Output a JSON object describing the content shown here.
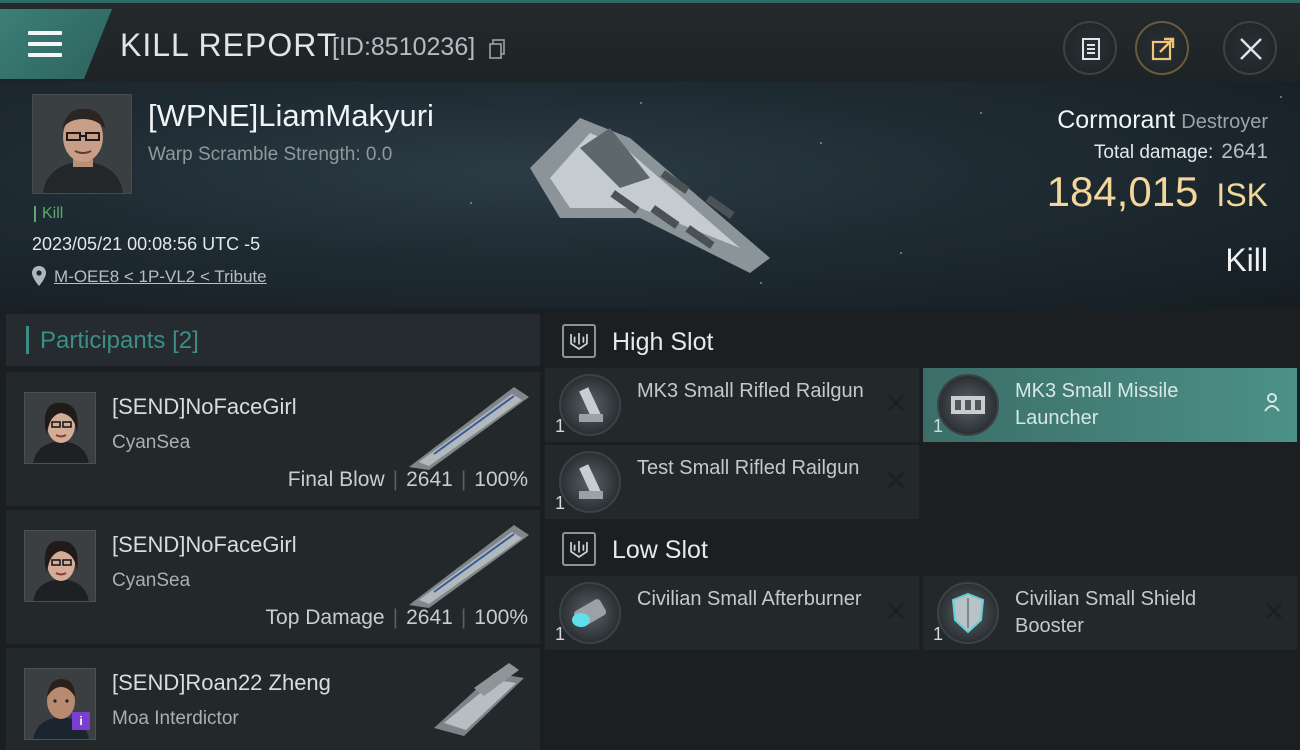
{
  "header": {
    "title": "KILL REPORT",
    "report_id": "[ID:8510236]"
  },
  "victim": {
    "name": "[WPNE]LiamMakyuri",
    "warp_scramble": "Warp Scramble Strength: 0.0",
    "tag": "Kill",
    "timestamp": "2023/05/21 00:08:56 UTC -5",
    "location": "M-OEE8 < 1P-VL2 < Tribute",
    "ship_name": "Cormorant",
    "ship_class": "Destroyer",
    "total_damage_label": "Total damage:",
    "total_damage": "2641",
    "isk_value": "184,015",
    "isk_unit": "ISK",
    "result": "Kill"
  },
  "participants": {
    "title": "Participants",
    "count": "[2]",
    "rows": [
      {
        "name": "[SEND]NoFaceGirl",
        "corp": "CyanSea",
        "role": "Final Blow",
        "damage": "2641",
        "percent": "100%"
      },
      {
        "name": "[SEND]NoFaceGirl",
        "corp": "CyanSea",
        "role": "Top Damage",
        "damage": "2641",
        "percent": "100%"
      },
      {
        "name": "[SEND]Roan22 Zheng",
        "corp": "Moa Interdictor",
        "badge": "i"
      }
    ]
  },
  "fitting": {
    "high_slot_title": "High Slot",
    "low_slot_title": "Low Slot",
    "high": [
      {
        "name": "MK3 Small Rifled Railgun",
        "qty": "1"
      },
      {
        "name": "MK3 Small Missile Launcher",
        "qty": "1"
      },
      {
        "name": "Test Small Rifled Railgun",
        "qty": "1"
      }
    ],
    "low": [
      {
        "name": "Civilian Small Afterburner",
        "qty": "1"
      },
      {
        "name": "Civilian Small Shield Booster",
        "qty": "1"
      }
    ]
  },
  "colors": {
    "accent_teal": "#3a8d85",
    "isk_gold": "#f3d79a",
    "kill_green": "#5fa86b"
  },
  "icons": [
    "menu-icon",
    "copy-icon",
    "clipboard-icon",
    "share-icon",
    "close-icon",
    "location-pin-icon",
    "slot-icon",
    "remove-icon",
    "pilot-icon"
  ]
}
